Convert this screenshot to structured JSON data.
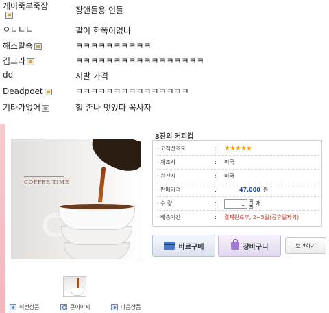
{
  "comments": [
    {
      "name": "게이죽부죽장",
      "text": "장앤들용 인들",
      "icon": "user-icon"
    },
    {
      "name": "ㅇㄴㄴㄴ",
      "text": "팔이 한쪽이없나",
      "icon": null
    },
    {
      "name": "해조랄숌",
      "text": "ㅋㅋㅋㅋㅋㅋㅋㅋㅋㅋ",
      "icon": "user-icon"
    },
    {
      "name": "김그라",
      "text": "ㅋㅋㅋㅋㅋㅋㅋㅋㅋㅋㅋㅋㅋㅋㅋㅋㅋ",
      "icon": "user-icon"
    },
    {
      "name": "dd",
      "text": "시발 가격",
      "icon": null
    },
    {
      "name": "Deadpoet",
      "text": "ㅋㅋㅋㅋㅋㅋㅋㅋㅋㅋㅋㅋㅋㅋㅋ",
      "icon": "user-icon"
    },
    {
      "name": "기타가없어",
      "text": "헐 존나 멋있다 꼭사자",
      "icon": "user-grey-icon"
    }
  ],
  "product": {
    "title": "3잔의 커피컵",
    "photo_caption": "COFFEE TIME",
    "info": {
      "rating_label": "· 고객선호도",
      "rating_stars": "★★★★★",
      "maker_label": "· 제조사",
      "maker_value": "미국",
      "origin_label": "· 원산지",
      "origin_value": "미국",
      "price_label": "· 판매가격",
      "price_value": "47,000",
      "price_unit": "원",
      "qty_label": "· 수 량",
      "qty_value": "1",
      "qty_unit": "개",
      "delivery_label": "· 배송기간",
      "delivery_value": "결제완료후, 2~5일(공휴일제외)",
      "colon": ":"
    },
    "buttons": {
      "buy": "바로구매",
      "cart": "장바구니",
      "keep": "보관하기"
    },
    "nav": {
      "prev": "이전상품",
      "zoom": "큰이미지",
      "next": "다음상품"
    }
  }
}
